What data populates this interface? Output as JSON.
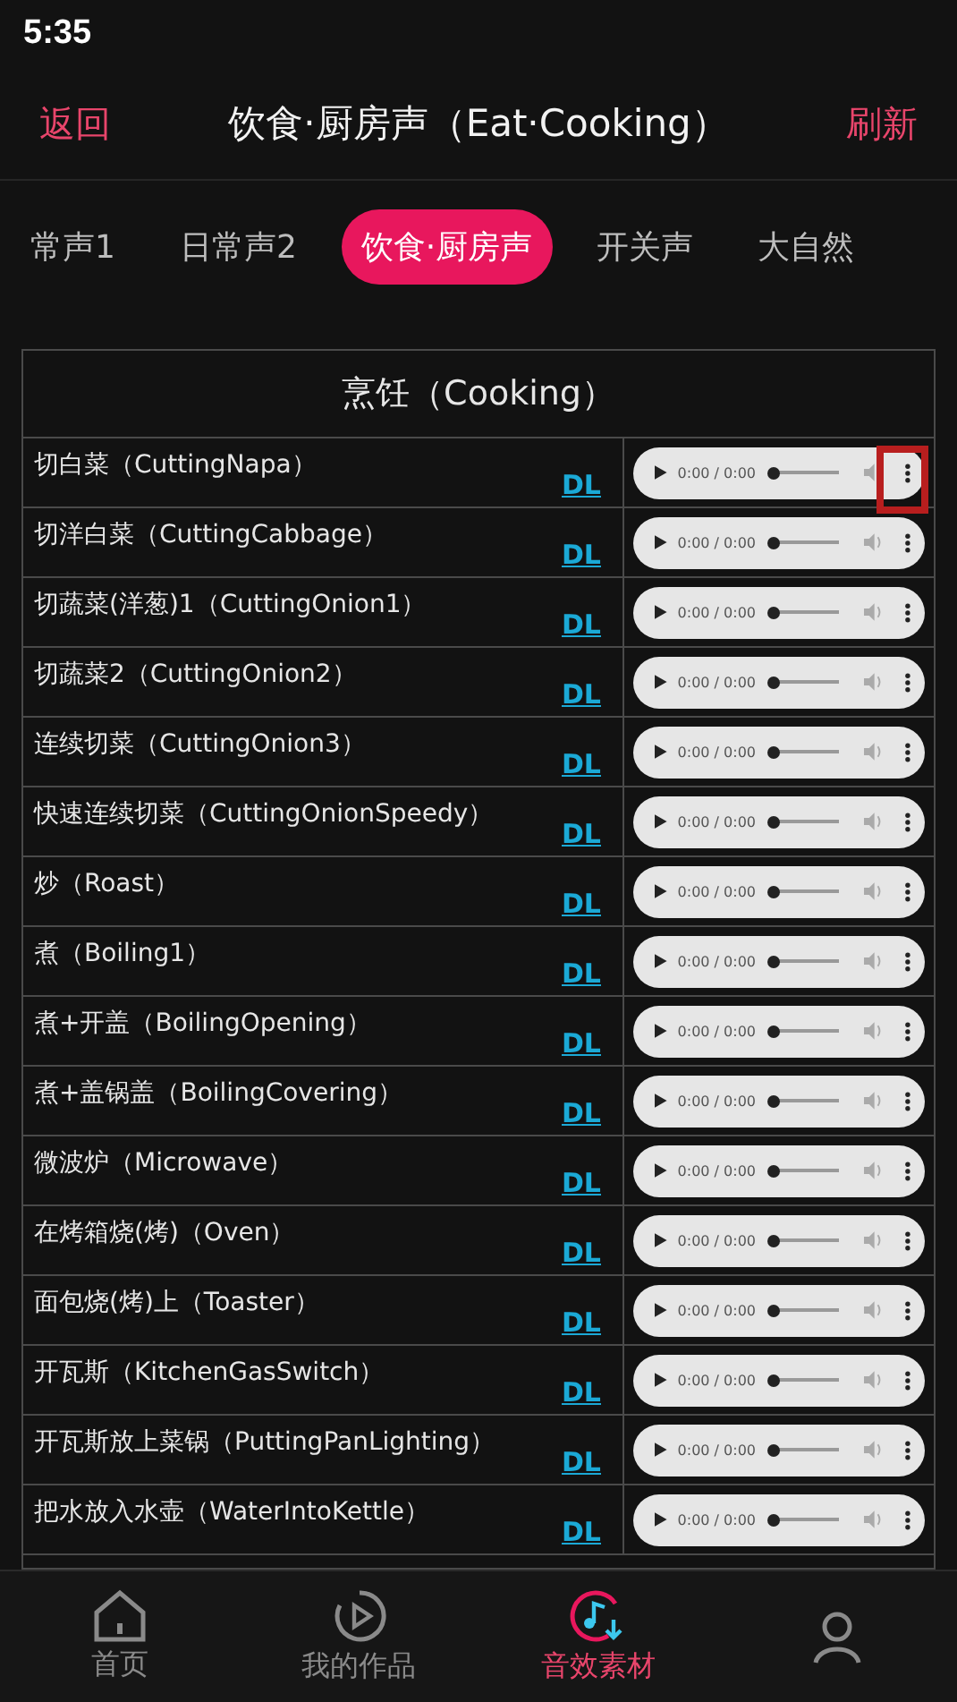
{
  "status_bar": {
    "time": "5:35"
  },
  "header": {
    "back": "返回",
    "title": "饮食·厨房声（Eat·Cooking）",
    "refresh": "刷新"
  },
  "tabs": [
    {
      "label": "常声1",
      "selected": false
    },
    {
      "label": "日常声2",
      "selected": false
    },
    {
      "label": "饮食·厨房声",
      "selected": true
    },
    {
      "label": "开关声",
      "selected": false
    },
    {
      "label": "大自然",
      "selected": false
    }
  ],
  "table": {
    "heading": "烹饪（Cooking）",
    "rows": [
      {
        "name": "切白菜（CuttingNapa）",
        "link": "DL",
        "time": "0:00 / 0:00",
        "level": 0
      },
      {
        "name": "切洋白菜（CuttingCabbage）",
        "link": "DL",
        "time": "0:00 / 0:00",
        "level": 0
      },
      {
        "name": "切蔬菜(洋葱)1（CuttingOnion1）",
        "link": "DL",
        "time": "0:00 / 0:00",
        "level": 0
      },
      {
        "name": "切蔬菜2（CuttingOnion2）",
        "link": "DL",
        "time": "0:00 / 0:00",
        "level": 0
      },
      {
        "name": "连续切菜（CuttingOnion3）",
        "link": "DL",
        "time": "0:00 / 0:00",
        "level": 0
      },
      {
        "name": "快速连续切菜（CuttingOnionSpeedy）",
        "link": "DL",
        "time": "0:00 / 0:00",
        "level": 0
      },
      {
        "name": "炒（Roast）",
        "link": "DL",
        "time": "0:00 / 0:00",
        "level": 0
      },
      {
        "name": "煮（Boiling1）",
        "link": "DL",
        "time": "0:00 / 0:00",
        "level": 0
      },
      {
        "name": "煮+开盖（BoilingOpening）",
        "link": "DL",
        "time": "0:00 / 0:00",
        "level": 0
      },
      {
        "name": "煮+盖锅盖（BoilingCovering）",
        "link": "DL",
        "time": "0:00 / 0:00",
        "level": 0
      },
      {
        "name": "微波炉（Microwave）",
        "link": "DL",
        "time": "0:00 / 0:00",
        "level": 0
      },
      {
        "name": "在烤箱烧(烤)（Oven）",
        "link": "DL",
        "time": "0:00 / 0:00",
        "level": 0
      },
      {
        "name": "面包烧(烤)上（Toaster）",
        "link": "DL",
        "time": "0:00 / 0:00",
        "level": 0
      },
      {
        "name": "开瓦斯（KitchenGasSwitch）",
        "link": "DL",
        "time": "0:00 / 0:00",
        "level": 0
      },
      {
        "name": "开瓦斯放上菜锅（PuttingPanLighting）",
        "link": "DL",
        "time": "0:00 / 0:00",
        "level": 0
      },
      {
        "name": "把水放入水壶（WaterIntoKettle）",
        "link": "DL",
        "time": "0:00 / 0:00",
        "level": 0
      }
    ]
  },
  "nav": [
    {
      "kind": "home",
      "label": "首页",
      "selected": false
    },
    {
      "kind": "play",
      "label": "我的作品",
      "selected": false
    },
    {
      "kind": "music",
      "label": "音效素材",
      "selected": true
    },
    {
      "kind": "person",
      "selected": false
    }
  ]
}
